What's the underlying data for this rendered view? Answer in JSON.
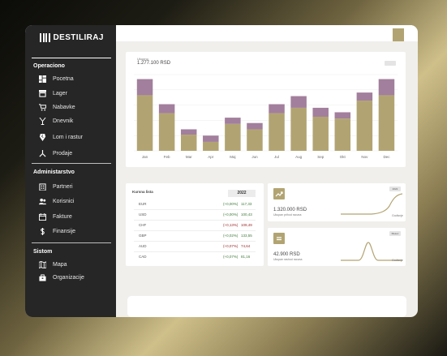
{
  "app": {
    "brand": "DESTILIRAJ"
  },
  "sidebar": {
    "sections": [
      {
        "title": "Operaciono",
        "items": [
          "Pocetna",
          "Lager",
          "Nabavke",
          "Dnevnik",
          "Lom i rastur",
          "Prodaje"
        ]
      },
      {
        "title": "Administarstvo",
        "items": [
          "Partneri",
          "Korisnici",
          "Fakture",
          "Finansije"
        ]
      },
      {
        "title": "Sistom",
        "items": [
          "Mapa",
          "Organizacije"
        ]
      }
    ],
    "icons": {
      "Pocetna": "dashboard-icon",
      "Lager": "warehouse-icon",
      "Nabavke": "cart-icon",
      "Dnevnik": "cocktail-icon",
      "Lom i rastur": "broken-glass-icon",
      "Prodaje": "sales-icon",
      "Partneri": "building-icon",
      "Korisnici": "users-icon",
      "Fakture": "invoice-icon",
      "Finansije": "dollar-icon",
      "Mapa": "map-icon",
      "Organizacije": "organization-icon"
    }
  },
  "main_chart": {
    "label": "Ukupno",
    "total": "1.277.100 RSD",
    "colors": {
      "base": "#b2a472",
      "top": "#a27f9c"
    },
    "chart_data": {
      "type": "bar",
      "stacked": true,
      "categories": [
        "Jan",
        "Feb",
        "Mar",
        "Apr",
        "Maj",
        "Jun",
        "Jul",
        "Aug",
        "Sep",
        "Okt",
        "Nov",
        "Dec"
      ],
      "series": [
        {
          "values": [
            62,
            42,
            18,
            10,
            30,
            24,
            42,
            48,
            38,
            36,
            56,
            62
          ]
        },
        {
          "values": [
            18,
            10,
            6,
            7,
            7,
            7,
            10,
            13,
            10,
            7,
            9,
            18
          ]
        }
      ],
      "ylim": [
        0,
        85
      ],
      "grid": true
    }
  },
  "currency": {
    "title": "Kursna lista",
    "year": "2022",
    "rows": [
      {
        "code": "EUR",
        "change": "(+0,00%)",
        "value": "117,33"
      },
      {
        "code": "USD",
        "change": "(+0,00%)",
        "value": "100,43"
      },
      {
        "code": "CHF",
        "change": "(+0,13%)",
        "value": "109,49"
      },
      {
        "code": "GBP",
        "change": "(+0,02%)",
        "value": "133,55"
      },
      {
        "code": "AUD",
        "change": "(+0,07%)",
        "value": "74,64"
      },
      {
        "code": "CAD",
        "change": "(+0,07%)",
        "value": "81,16"
      }
    ],
    "colors": {
      "up": "#3f7a3a",
      "down": "#9a2a2a"
    }
  },
  "kpis": [
    {
      "amount": "1.320.000 RSD",
      "caption": "Ukupan prihod racuna",
      "pill": "2022",
      "corner": "Godisnje",
      "icon": "trend-up-icon"
    },
    {
      "amount": "42.900 RSD",
      "caption": "Ukupan rashod racuna",
      "pill": "Mesec",
      "corner": "Godisnje",
      "icon": "minus-icon"
    }
  ]
}
